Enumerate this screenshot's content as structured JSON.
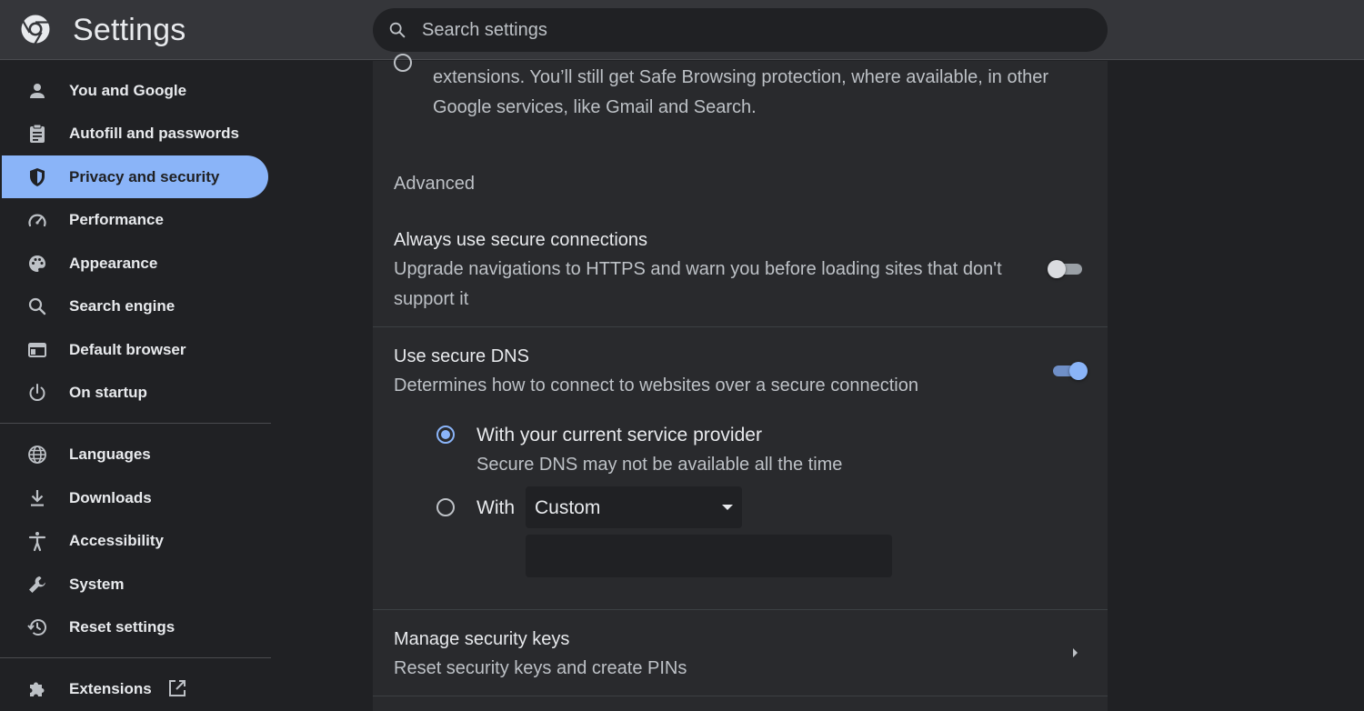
{
  "app": {
    "title": "Settings"
  },
  "search": {
    "placeholder": "Search settings"
  },
  "sidebar": {
    "items": [
      {
        "label": "You and Google",
        "icon": "person-icon"
      },
      {
        "label": "Autofill and passwords",
        "icon": "clipboard-icon"
      },
      {
        "label": "Privacy and security",
        "icon": "shield-icon",
        "active": true
      },
      {
        "label": "Performance",
        "icon": "speedometer-icon"
      },
      {
        "label": "Appearance",
        "icon": "palette-icon"
      },
      {
        "label": "Search engine",
        "icon": "search-icon"
      },
      {
        "label": "Default browser",
        "icon": "browser-window-icon"
      },
      {
        "label": "On startup",
        "icon": "power-icon"
      },
      {
        "label": "Languages",
        "icon": "globe-icon"
      },
      {
        "label": "Downloads",
        "icon": "download-icon"
      },
      {
        "label": "Accessibility",
        "icon": "accessibility-icon"
      },
      {
        "label": "System",
        "icon": "wrench-icon"
      },
      {
        "label": "Reset settings",
        "icon": "history-icon"
      },
      {
        "label": "Extensions",
        "icon": "puzzle-icon",
        "external": "open-in-new-icon"
      }
    ]
  },
  "main": {
    "top_option_text": "extensions. You’ll still get Safe Browsing protection, where available, in other Google services, like Gmail and Search.",
    "advanced_title": "Advanced",
    "https_first": {
      "title": "Always use secure connections",
      "description": "Upgrade navigations to HTTPS and warn you before loading sites that don't support it",
      "enabled": false
    },
    "secure_dns": {
      "title": "Use secure DNS",
      "description": "Determines how to connect to websites over a secure connection",
      "enabled": true,
      "option_current": {
        "label": "With your current service provider",
        "sublabel": "Secure DNS may not be available all the time",
        "selected": true
      },
      "option_custom": {
        "label": "With",
        "selected": false,
        "provider_value": "Custom",
        "custom_value": ""
      }
    },
    "security_keys": {
      "title": "Manage security keys",
      "description": "Reset security keys and create PINs"
    }
  },
  "colors": {
    "accent": "#8ab4f8",
    "background": "#202124",
    "card": "#292a2d",
    "header": "#35363a"
  }
}
